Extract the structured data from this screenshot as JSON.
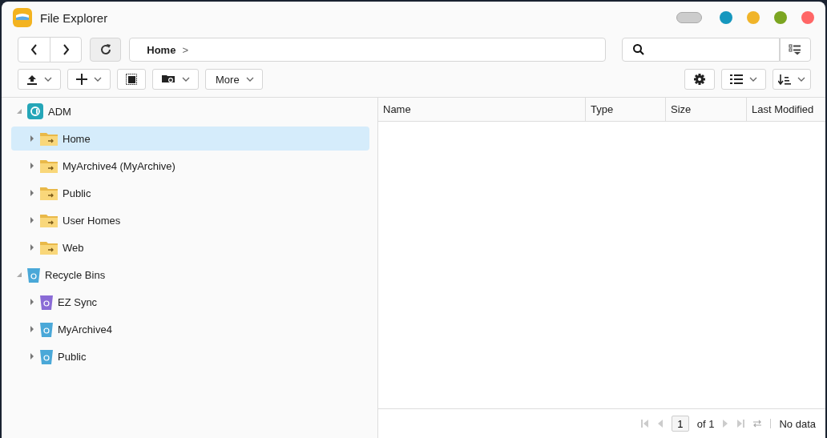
{
  "window": {
    "title": "File Explorer"
  },
  "breadcrumb": {
    "path": "Home",
    "separator": ">"
  },
  "toolbar": {
    "more_label": "More"
  },
  "tree": [
    {
      "label": "ADM",
      "kind": "system",
      "expanded": true,
      "selected": false,
      "children": [
        {
          "label": "Home",
          "kind": "share",
          "expanded": false,
          "selected": true
        },
        {
          "label": "MyArchive4 (MyArchive)",
          "kind": "share",
          "expanded": false,
          "selected": false
        },
        {
          "label": "Public",
          "kind": "share",
          "expanded": false,
          "selected": false
        },
        {
          "label": "User Homes",
          "kind": "share",
          "expanded": false,
          "selected": false
        },
        {
          "label": "Web",
          "kind": "share",
          "expanded": false,
          "selected": false
        }
      ]
    },
    {
      "label": "Recycle Bins",
      "kind": "bin",
      "color": "#4aa8d8",
      "expanded": true,
      "selected": false,
      "children": [
        {
          "label": "EZ Sync",
          "kind": "bin",
          "color": "#8a6bd6",
          "expanded": false,
          "selected": false
        },
        {
          "label": "MyArchive4",
          "kind": "bin",
          "color": "#4aa8d8",
          "expanded": false,
          "selected": false
        },
        {
          "label": "Public",
          "kind": "bin",
          "color": "#4aa8d8",
          "expanded": false,
          "selected": false
        }
      ]
    }
  ],
  "table": {
    "columns": [
      "Name",
      "Type",
      "Size",
      "Last Modified"
    ]
  },
  "pager": {
    "page": "1",
    "of": "of 1",
    "status": "No data"
  }
}
